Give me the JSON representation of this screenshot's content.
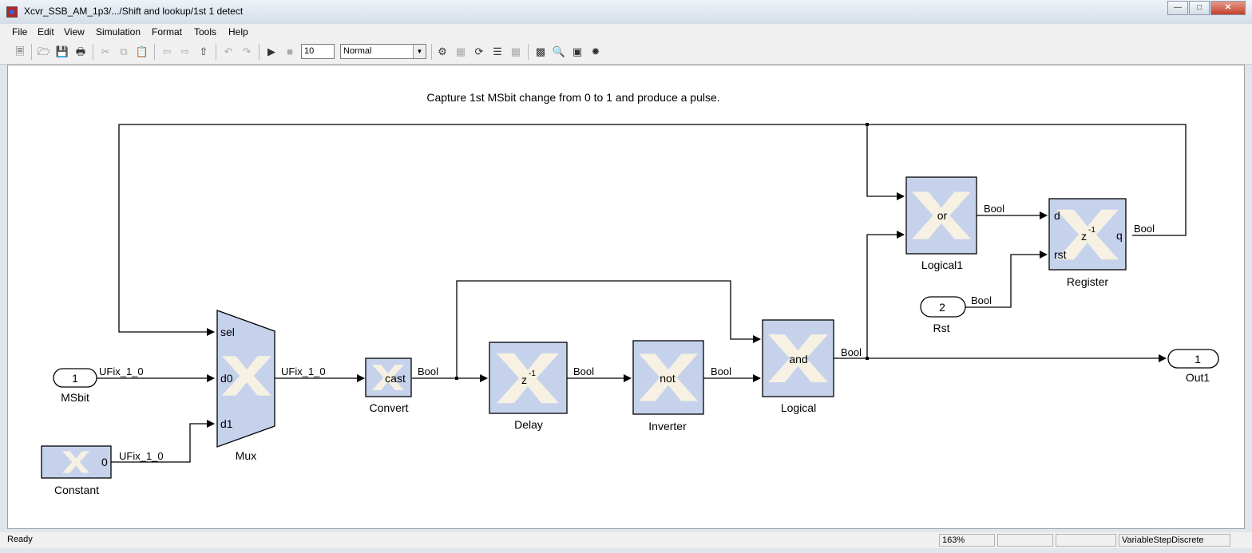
{
  "window": {
    "title": "Xcvr_SSB_AM_1p3/.../Shift and lookup/1st 1 detect"
  },
  "menu": [
    "File",
    "Edit",
    "View",
    "Simulation",
    "Format",
    "Tools",
    "Help"
  ],
  "toolbar": {
    "stop_time": "10",
    "sim_mode": "Normal"
  },
  "canvas": {
    "annotation": "Capture 1st MSbit change from 0 to 1 and produce a pulse.",
    "blocks": {
      "msbit": {
        "value": "1",
        "name": "MSbit"
      },
      "constant": {
        "value": "0",
        "name": "Constant"
      },
      "mux": {
        "name": "Mux",
        "port_sel": "sel",
        "port_d0": "d0",
        "port_d1": "d1"
      },
      "convert": {
        "text": "cast",
        "name": "Convert"
      },
      "delay": {
        "text": "z",
        "exp": "-1",
        "name": "Delay"
      },
      "inverter": {
        "text": "not",
        "name": "Inverter"
      },
      "logical": {
        "text": "and",
        "name": "Logical"
      },
      "logical1": {
        "text": "or",
        "name": "Logical1"
      },
      "register": {
        "text": "z",
        "exp": "-1",
        "name": "Register",
        "port_d": "d",
        "port_rst": "rst",
        "port_q": "q"
      },
      "rst": {
        "value": "2",
        "name": "Rst"
      },
      "out1": {
        "value": "1",
        "name": "Out1"
      }
    },
    "signals": {
      "msbit_mux": "UFix_1_0",
      "const_mux": "UFix_1_0",
      "mux_convert": "UFix_1_0",
      "convert_delay": "Bool",
      "delay_inverter": "Bool",
      "inverter_logical": "Bool",
      "logical_out": "Bool",
      "logical1_register": "Bool",
      "register_q": "Bool",
      "rst_register": "Bool"
    }
  },
  "status": {
    "ready": "Ready",
    "zoom": "163%",
    "solver": "VariableStepDiscrete"
  }
}
